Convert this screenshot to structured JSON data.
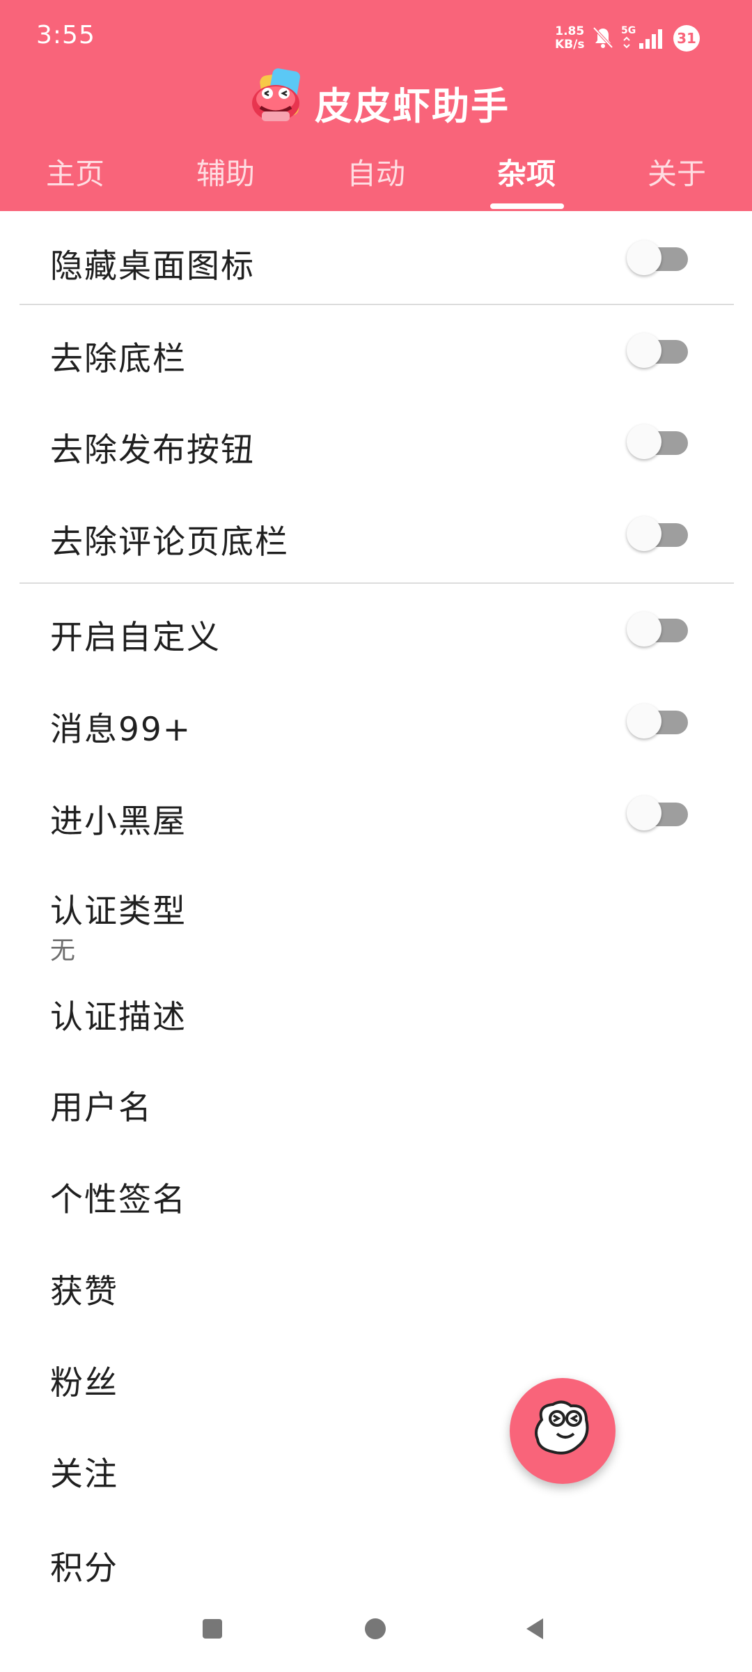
{
  "status_bar": {
    "time": "3:55",
    "net_speed_value": "1.85",
    "net_speed_unit": "KB/s",
    "network": "5G",
    "notification_count": "31"
  },
  "app": {
    "title": "皮皮虾助手"
  },
  "tabs": [
    {
      "label": "主页"
    },
    {
      "label": "辅助"
    },
    {
      "label": "自动"
    },
    {
      "label": "杂项"
    },
    {
      "label": "关于"
    }
  ],
  "active_tab": "杂项",
  "settings": {
    "hide_icon": {
      "label": "隐藏桌面图标",
      "on": false
    },
    "remove_bottom_bar": {
      "label": "去除底栏",
      "on": false
    },
    "remove_publish_button": {
      "label": "去除发布按钮",
      "on": false
    },
    "remove_comment_bottom_bar": {
      "label": "去除评论页底栏",
      "on": false
    },
    "enable_custom": {
      "label": "开启自定义",
      "on": false
    },
    "message_99": {
      "label": "消息99+",
      "on": false
    },
    "black_room": {
      "label": "进小黑屋",
      "on": false
    },
    "auth_type": {
      "label": "认证类型",
      "value": "无"
    },
    "auth_desc": {
      "label": "认证描述"
    },
    "username": {
      "label": "用户名"
    },
    "signature": {
      "label": "个性签名"
    },
    "likes": {
      "label": "获赞"
    },
    "fans": {
      "label": "粉丝"
    },
    "follows": {
      "label": "关注"
    },
    "points": {
      "label": "积分"
    }
  },
  "colors": {
    "accent": "#f9647a",
    "switch_off_track": "#9e9e9e",
    "switch_off_thumb": "#fafafa"
  }
}
